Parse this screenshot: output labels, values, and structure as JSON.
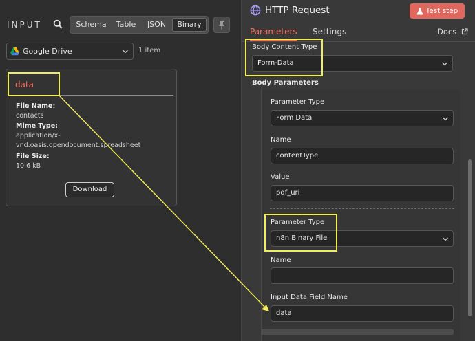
{
  "input_panel": {
    "title": "INPUT",
    "view_modes": [
      "Schema",
      "Table",
      "JSON",
      "Binary"
    ],
    "active_view_mode": "Binary",
    "source": "Google Drive",
    "item_count": "1 item",
    "binary_card": {
      "property": "data",
      "file_name_label": "File Name:",
      "file_name": "contacts",
      "mime_type_label": "Mime Type:",
      "mime_type_line1": "application/x-",
      "mime_type_line2": "vnd.oasis.opendocument.spreadsheet",
      "file_size_label": "File Size:",
      "file_size": "10.6 kB",
      "download_label": "Download"
    }
  },
  "node_panel": {
    "title": "HTTP Request",
    "test_button": "Test step",
    "tabs": [
      "Parameters",
      "Settings"
    ],
    "active_tab": "Parameters",
    "docs_link": "Docs",
    "body_content_type_label": "Body Content Type",
    "body_content_type": "Form-Data",
    "body_parameters_label": "Body Parameters",
    "parameters": [
      {
        "type_label": "Parameter Type",
        "type": "Form Data",
        "name_label": "Name",
        "name": "contentType",
        "value_label": "Value",
        "value": "pdf_uri"
      },
      {
        "type_label": "Parameter Type",
        "type": "n8n Binary File",
        "name_label": "Name",
        "name": "",
        "field_label": "Input Data Field Name",
        "field_value": "data"
      }
    ]
  },
  "colors": {
    "highlight": "#f2ee5a",
    "accent": "#ee7260",
    "test_button": "#e0675e"
  }
}
